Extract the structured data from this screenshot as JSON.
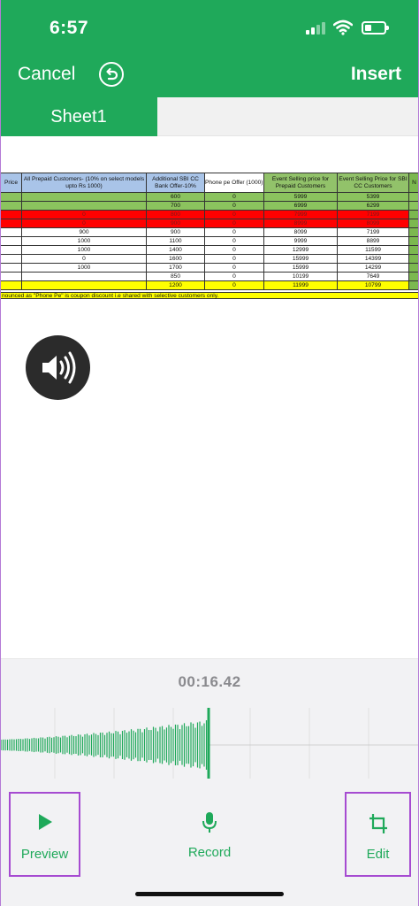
{
  "status_bar": {
    "time": "6:57"
  },
  "nav": {
    "cancel_label": "Cancel",
    "insert_label": "Insert"
  },
  "sheets": {
    "active_tab": "Sheet1"
  },
  "spreadsheet": {
    "headers": {
      "price": "Price",
      "prepaid": "All Prepaid Customers- (10% on select models upto Rs 1000)",
      "sbi": "Additional SBI CC Bank Offer-10%",
      "phonepe": "Phone pe Offer (1000)",
      "event_prepaid": "Event Selling price for Prepaid Customers",
      "event_sbi": "Event Selling Price for SBI CC Customers",
      "edge": "N"
    },
    "rows": [
      {
        "style": "green",
        "prepaid": "",
        "sbi": "600",
        "phonepe": "0",
        "event_prepaid": "5999",
        "event_sbi": "5399"
      },
      {
        "style": "green",
        "prepaid": "",
        "sbi": "700",
        "phonepe": "0",
        "event_prepaid": "6999",
        "event_sbi": "6299"
      },
      {
        "style": "red",
        "prepaid": "0",
        "sbi": "800",
        "phonepe": "0",
        "event_prepaid": "7999",
        "event_sbi": "7199"
      },
      {
        "style": "red",
        "prepaid": "0",
        "sbi": "900",
        "phonepe": "0",
        "event_prepaid": "8999",
        "event_sbi": "8099"
      },
      {
        "style": "white",
        "prepaid": "900",
        "sbi": "900",
        "phonepe": "0",
        "event_prepaid": "8099",
        "event_sbi": "7199"
      },
      {
        "style": "white",
        "prepaid": "1000",
        "sbi": "1100",
        "phonepe": "0",
        "event_prepaid": "9999",
        "event_sbi": "8899"
      },
      {
        "style": "white",
        "prepaid": "1000",
        "sbi": "1400",
        "phonepe": "0",
        "event_prepaid": "12999",
        "event_sbi": "11599"
      },
      {
        "style": "white",
        "prepaid": "0",
        "sbi": "1600",
        "phonepe": "0",
        "event_prepaid": "15999",
        "event_sbi": "14399"
      },
      {
        "style": "white",
        "prepaid": "1000",
        "sbi": "1700",
        "phonepe": "0",
        "event_prepaid": "15999",
        "event_sbi": "14299"
      },
      {
        "style": "white",
        "prepaid": "",
        "sbi": "850",
        "phonepe": "0",
        "event_prepaid": "10199",
        "event_sbi": "7649"
      },
      {
        "style": "yellow",
        "prepaid": "",
        "sbi": "1200",
        "phonepe": "0",
        "event_prepaid": "11999",
        "event_sbi": "10799"
      }
    ],
    "footnote": "nounced as \"Phone Pe\" is coupon discount i.e shared with selective customers only."
  },
  "recorder": {
    "elapsed": "00:16.42",
    "preview_label": "Preview",
    "record_label": "Record",
    "edit_label": "Edit"
  },
  "icons": {
    "undo": "undo-icon",
    "speaker": "speaker-icon",
    "play": "play-icon",
    "mic": "microphone-icon",
    "crop": "crop-icon"
  },
  "colors": {
    "brand_green": "#1fa95a",
    "highlight_purple": "#a64bd1"
  }
}
